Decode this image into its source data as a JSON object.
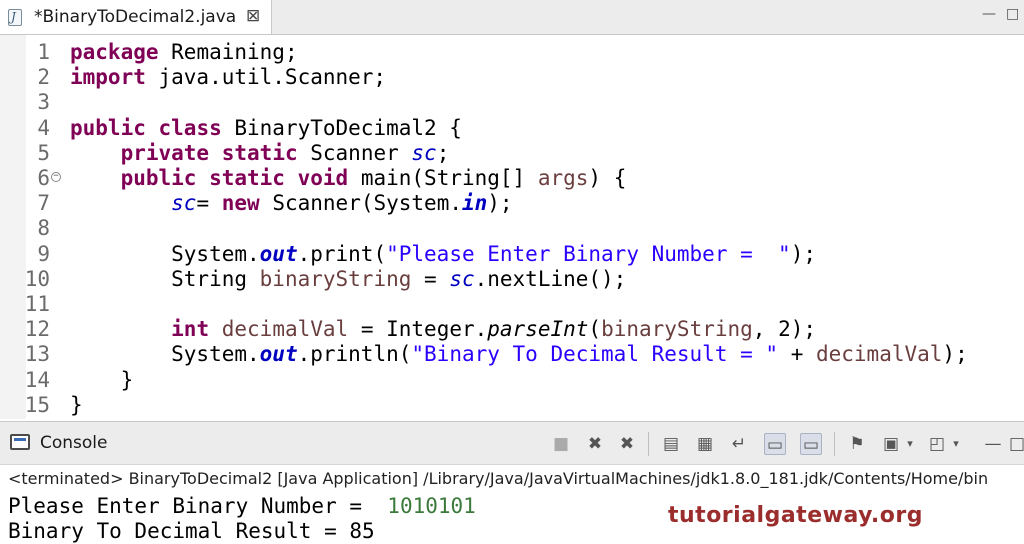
{
  "editor_tab": {
    "title": "*BinaryToDecimal2.java",
    "close": "⊠",
    "icon_letter": "J"
  },
  "window_controls": {
    "minimize": "—",
    "maximize": "□"
  },
  "code_lines": [
    {
      "n": "1",
      "segs": [
        {
          "t": "package",
          "c": "kw"
        },
        {
          "t": " Remaining;",
          "c": ""
        }
      ]
    },
    {
      "n": "2",
      "segs": [
        {
          "t": "import",
          "c": "kw"
        },
        {
          "t": " java.util.Scanner;",
          "c": ""
        }
      ]
    },
    {
      "n": "3",
      "segs": []
    },
    {
      "n": "4",
      "segs": [
        {
          "t": "public",
          "c": "kw"
        },
        {
          "t": " ",
          "c": ""
        },
        {
          "t": "class",
          "c": "kw"
        },
        {
          "t": " BinaryToDecimal2 {",
          "c": ""
        }
      ]
    },
    {
      "n": "5",
      "segs": [
        {
          "t": "    ",
          "c": ""
        },
        {
          "t": "private",
          "c": "kw"
        },
        {
          "t": " ",
          "c": ""
        },
        {
          "t": "static",
          "c": "kw"
        },
        {
          "t": " Scanner ",
          "c": ""
        },
        {
          "t": "sc",
          "c": "fld"
        },
        {
          "t": ";",
          "c": ""
        }
      ]
    },
    {
      "n": "6",
      "segs": [
        {
          "t": "    ",
          "c": ""
        },
        {
          "t": "public",
          "c": "kw"
        },
        {
          "t": " ",
          "c": ""
        },
        {
          "t": "static",
          "c": "kw"
        },
        {
          "t": " ",
          "c": ""
        },
        {
          "t": "void",
          "c": "kw"
        },
        {
          "t": " main(String[] ",
          "c": ""
        },
        {
          "t": "args",
          "c": "var"
        },
        {
          "t": ") {",
          "c": ""
        }
      ],
      "fold": true
    },
    {
      "n": "7",
      "segs": [
        {
          "t": "        ",
          "c": ""
        },
        {
          "t": "sc",
          "c": "fld"
        },
        {
          "t": "= ",
          "c": ""
        },
        {
          "t": "new",
          "c": "kw"
        },
        {
          "t": " Scanner(System.",
          "c": ""
        },
        {
          "t": "in",
          "c": "fldb"
        },
        {
          "t": ");",
          "c": ""
        }
      ]
    },
    {
      "n": "8",
      "segs": []
    },
    {
      "n": "9",
      "segs": [
        {
          "t": "        System.",
          "c": ""
        },
        {
          "t": "out",
          "c": "fldb"
        },
        {
          "t": ".print(",
          "c": ""
        },
        {
          "t": "\"Please Enter Binary Number =  \"",
          "c": "str"
        },
        {
          "t": ");",
          "c": ""
        }
      ]
    },
    {
      "n": "10",
      "segs": [
        {
          "t": "        String ",
          "c": ""
        },
        {
          "t": "binaryString",
          "c": "var"
        },
        {
          "t": " = ",
          "c": ""
        },
        {
          "t": "sc",
          "c": "fld"
        },
        {
          "t": ".nextLine();",
          "c": ""
        }
      ]
    },
    {
      "n": "11",
      "segs": []
    },
    {
      "n": "12",
      "segs": [
        {
          "t": "        ",
          "c": ""
        },
        {
          "t": "int",
          "c": "kw"
        },
        {
          "t": " ",
          "c": ""
        },
        {
          "t": "decimalVal",
          "c": "var"
        },
        {
          "t": " = Integer.",
          "c": ""
        },
        {
          "t": "parseInt",
          "c": "ital"
        },
        {
          "t": "(",
          "c": ""
        },
        {
          "t": "binaryString",
          "c": "var"
        },
        {
          "t": ", 2);",
          "c": ""
        }
      ]
    },
    {
      "n": "13",
      "segs": [
        {
          "t": "        System.",
          "c": ""
        },
        {
          "t": "out",
          "c": "fldb"
        },
        {
          "t": ".println(",
          "c": ""
        },
        {
          "t": "\"Binary To Decimal Result = \"",
          "c": "str"
        },
        {
          "t": " + ",
          "c": ""
        },
        {
          "t": "decimalVal",
          "c": "var"
        },
        {
          "t": ");",
          "c": ""
        }
      ]
    },
    {
      "n": "14",
      "segs": [
        {
          "t": "    }",
          "c": ""
        }
      ]
    },
    {
      "n": "15",
      "segs": [
        {
          "t": "}",
          "c": ""
        }
      ]
    }
  ],
  "console": {
    "tab_label": "Console",
    "status": "<terminated> BinaryToDecimal2 [Java Application] /Library/Java/JavaVirtualMachines/jdk1.8.0_181.jdk/Contents/Home/bin",
    "output": [
      {
        "prompt": "Please Enter Binary Number =  ",
        "input": "1010101"
      },
      {
        "prompt": "Binary To Decimal Result = 85",
        "input": ""
      }
    ]
  },
  "toolbar_icons": [
    "terminate-icon",
    "remove-launch-icon",
    "remove-all-terminated-icon",
    "clear-console-icon",
    "scroll-lock-icon",
    "word-wrap-icon",
    "show-on-stdout-icon",
    "show-on-stderr-icon",
    "pin-console-icon",
    "display-selected-console-icon",
    "open-console-icon",
    "minimize-icon",
    "maximize-icon"
  ],
  "watermark": "tutorialgateway.org"
}
